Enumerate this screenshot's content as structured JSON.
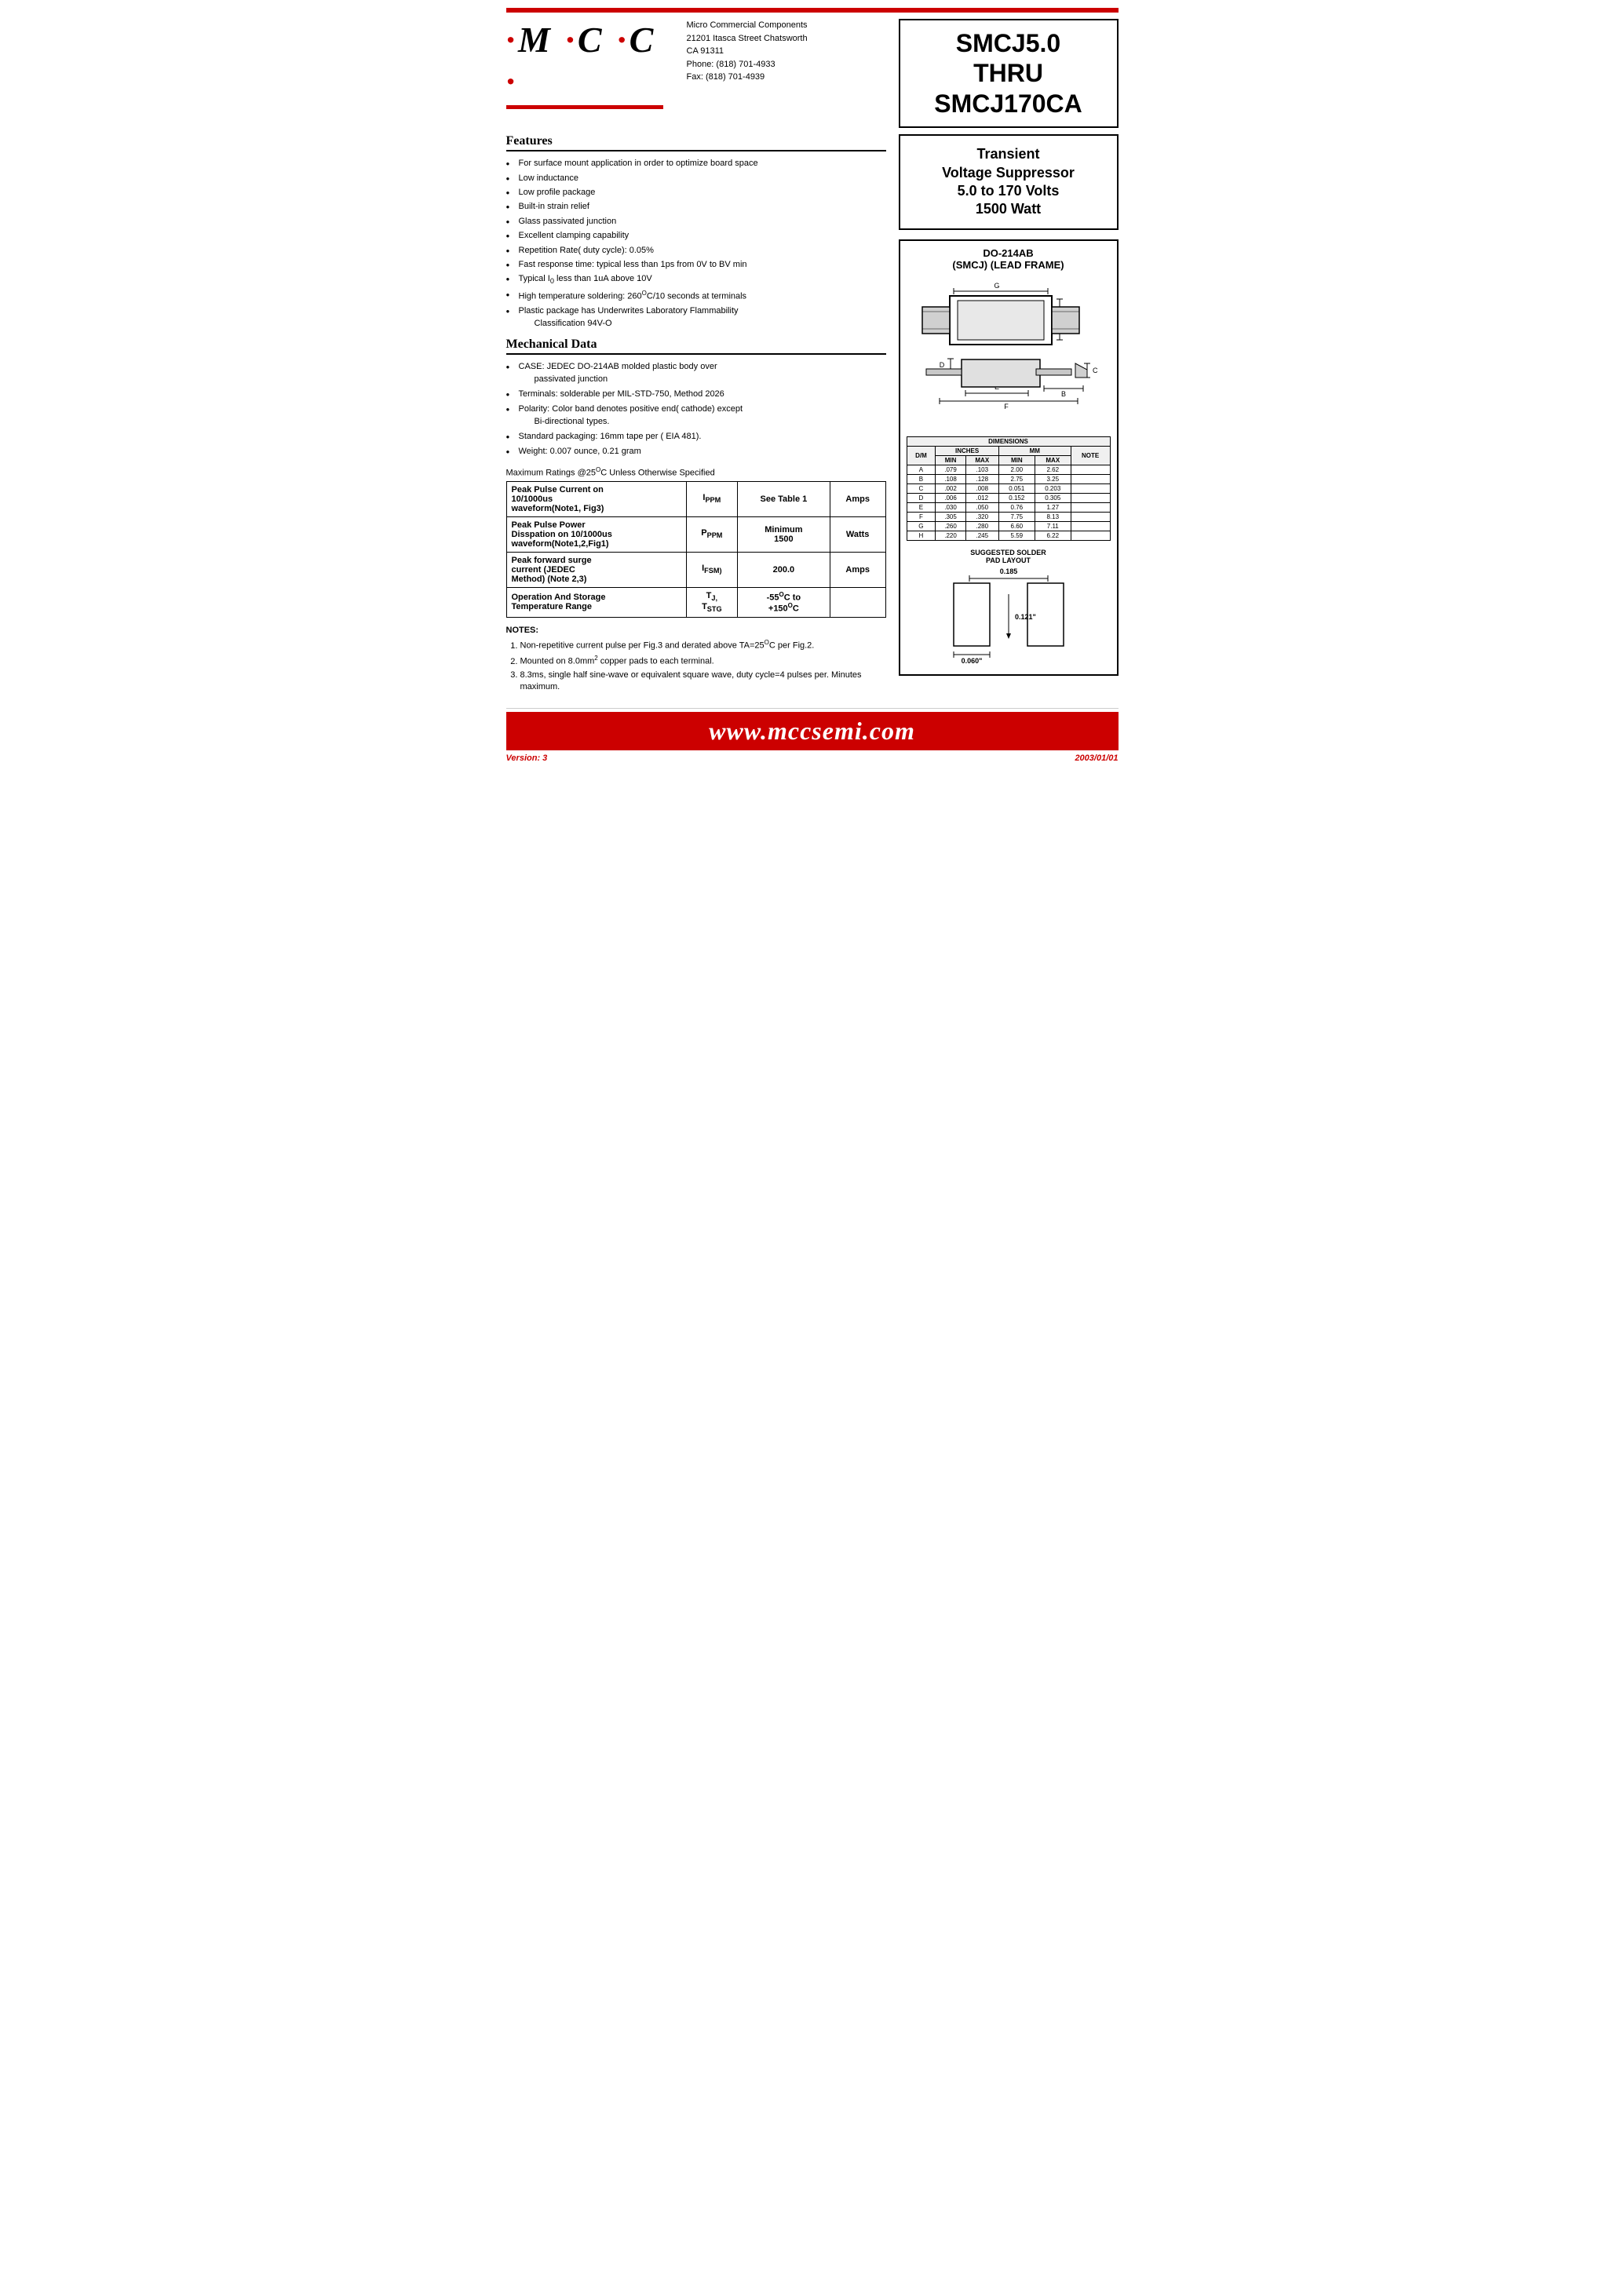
{
  "topBar": {},
  "header": {
    "logo": "·M·C·C·",
    "company": {
      "name": "Micro Commercial Components",
      "address1": "21201 Itasca Street Chatsworth",
      "address2": "CA 91311",
      "phone": "Phone: (818) 701-4933",
      "fax": "Fax:    (818) 701-4939"
    },
    "partNumber": "SMCJ5.0\nTHRU\nSMCJ170CA"
  },
  "transient": {
    "title": "Transient\nVoltage Suppressor\n5.0 to 170 Volts\n1500 Watt"
  },
  "package": {
    "title1": "DO-214AB",
    "title2": "(SMCJ) (LEAD FRAME)"
  },
  "features": {
    "title": "Features",
    "items": [
      "For surface mount application in order to optimize board space",
      "Low inductance",
      "Low profile package",
      "Built-in strain relief",
      "Glass passivated junction",
      "Excellent clamping capability",
      "Repetition Rate( duty cycle): 0.05%",
      "Fast response time: typical less than 1ps from 0V to BV min",
      "Typical I₀ less than 1uA above 10V",
      "High temperature soldering: 260°C/10 seconds at terminals",
      "Plastic package has Underwrites Laboratory Flammability Classification 94V-O"
    ]
  },
  "mechanical": {
    "title": "Mechanical Data",
    "items": [
      "CASE: JEDEC DO-214AB molded plastic body over passivated junction",
      "Terminals:  solderable per MIL-STD-750, Method 2026",
      "Polarity: Color band denotes positive end( cathode) except Bi-directional types.",
      "Standard packaging: 16mm tape per ( EIA 481).",
      "Weight: 0.007 ounce, 0.21 gram"
    ]
  },
  "maxRatings": {
    "note": "Maximum Ratings @25°C Unless Otherwise Specified",
    "rows": [
      {
        "desc1": "Peak Pulse Current on",
        "desc2": "10/1000us",
        "desc3": "waveform(Note1, Fig3)",
        "symbol": "I",
        "symbolSub": "PPM",
        "value": "See Table 1",
        "unit": "Amps"
      },
      {
        "desc1": "Peak Pulse Power",
        "desc2": "Disspation on 10/1000us",
        "desc3": "waveform(Note1,2,Fig1)",
        "symbol": "P",
        "symbolSub": "PPM",
        "value": "Minimum\n1500",
        "unit": "Watts"
      },
      {
        "desc1": "Peak forward surge",
        "desc2": "current (JEDEC",
        "desc3": "Method) (Note 2,3)",
        "symbol": "I",
        "symbolSub": "FSM)",
        "value": "200.0",
        "unit": "Amps"
      },
      {
        "desc1": "Operation And Storage",
        "desc2": "Temperature Range",
        "symbol": "T",
        "symbolSub": "J,",
        "symbolSub2": "T",
        "symbolSub3": "STG",
        "value": "-55°C to\n+150°C",
        "unit": ""
      }
    ]
  },
  "notes": {
    "title": "NOTES:",
    "items": [
      "Non-repetitive current pulse per Fig.3 and derated above TA=25°C per Fig.2.",
      "Mounted on 8.0mm² copper pads to each terminal.",
      "8.3ms, single half sine-wave or equivalent square wave, duty cycle=4 pulses per. Minutes maximum."
    ]
  },
  "dimensions": {
    "title": "DIMENSIONS",
    "headers": [
      "D/M",
      "MIN",
      "MAX",
      "MIN",
      "MAX",
      "NOTE"
    ],
    "subHeaders": [
      "",
      "INCHES",
      "",
      "MM",
      "",
      ""
    ],
    "rows": [
      [
        "A",
        ".079",
        ".103",
        "2.00",
        "2.62",
        ""
      ],
      [
        "B",
        ".108",
        ".128",
        "2.75",
        "3.25",
        ""
      ],
      [
        "C",
        ".002",
        ".008",
        "0.051",
        "0.203",
        ""
      ],
      [
        "D",
        ".006",
        ".012",
        "0.152",
        "0.305",
        ""
      ],
      [
        "E",
        ".030",
        ".050",
        "0.76",
        "1.27",
        ""
      ],
      [
        "F",
        ".305",
        ".320",
        "7.75",
        "8.13",
        ""
      ],
      [
        "G",
        ".260",
        ".280",
        "6.60",
        "7.11",
        ""
      ],
      [
        "H",
        ".220",
        ".245",
        "5.59",
        "6.22",
        ""
      ]
    ]
  },
  "solderPad": {
    "title": "SUGGESTED SOLDER\nPAD LAYOUT",
    "dim1": "0.185",
    "dim2": "0.121\"",
    "dim3": "0.060\""
  },
  "footer": {
    "version": "Version: 3",
    "website": "www.mccsemi.com",
    "date": "2003/01/01"
  }
}
